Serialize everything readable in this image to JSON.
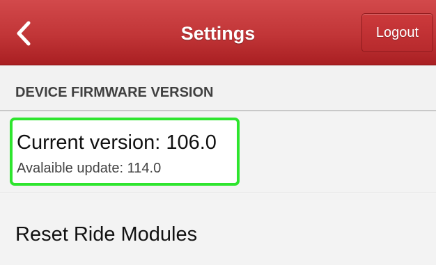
{
  "header": {
    "title": "Settings",
    "logout_label": "Logout",
    "back_icon": "chevron-left-icon",
    "bar_color": "#c13537"
  },
  "section": {
    "header": "DEVICE FIRMWARE VERSION"
  },
  "firmware": {
    "current_version": "Current version: 106.0",
    "available_update": "Avalaible update: 114.0",
    "highlight_color": "#2ee52e"
  },
  "actions": {
    "reset_label": "Reset Ride Modules"
  }
}
